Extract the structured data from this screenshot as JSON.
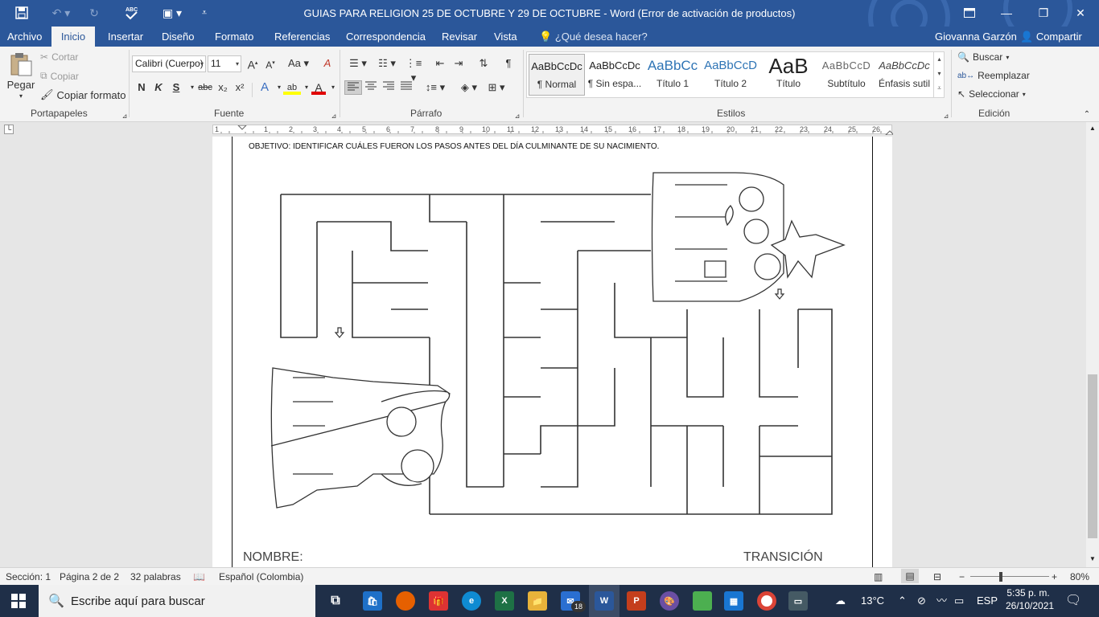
{
  "window": {
    "title": "GUIAS PARA RELIGION 25 DE OCTUBRE Y 29 DE OCTUBRE  -  Word (Error de activación de productos)",
    "minimize": "—",
    "restore": "❐",
    "close": "✕"
  },
  "quick_access": {
    "save_icon": "save-icon",
    "undo_icon": "undo-icon",
    "redo_icon": "redo-icon",
    "spelling_icon": "spelling-icon",
    "form_icon": "form-icon"
  },
  "menu": {
    "tabs": [
      "Archivo",
      "Inicio",
      "Insertar",
      "Diseño",
      "Formato",
      "Referencias",
      "Correspondencia",
      "Revisar",
      "Vista"
    ],
    "active_tab": "Inicio",
    "tell_me": "¿Qué desea hacer?",
    "user": "Giovanna Garzón",
    "share": "Compartir"
  },
  "ribbon": {
    "clipboard": {
      "paste": "Pegar",
      "cut": "Cortar",
      "copy": "Copiar",
      "format_painter": "Copiar formato",
      "label": "Portapapeles"
    },
    "font": {
      "name": "Calibri (Cuerpo)",
      "size": "11",
      "label": "Fuente",
      "bold": "N",
      "italic": "K",
      "underline": "S",
      "strike": "abc",
      "subscript": "x₂",
      "superscript": "x²",
      "grow": "A",
      "shrink": "A",
      "case": "Aa",
      "clear": "A",
      "effects": "A",
      "highlight": "ab",
      "color": "A"
    },
    "paragraph": {
      "label": "Párrafo"
    },
    "styles": {
      "label": "Estilos",
      "items": [
        {
          "sample": "AaBbCcDc",
          "name": "¶ Normal"
        },
        {
          "sample": "AaBbCcDc",
          "name": "¶ Sin espa..."
        },
        {
          "sample": "AaBbCc",
          "name": "Título 1"
        },
        {
          "sample": "AaBbCcD",
          "name": "Título 2"
        },
        {
          "sample": "AaB",
          "name": "Título"
        },
        {
          "sample": "AaBbCcD",
          "name": "Subtítulo"
        },
        {
          "sample": "AaBbCcDc",
          "name": "Énfasis sutil"
        }
      ]
    },
    "editing": {
      "find": "Buscar",
      "replace": "Reemplazar",
      "select": "Seleccionar",
      "label": "Edición"
    }
  },
  "ruler": {
    "numbers": [
      "1",
      "1",
      "2",
      "3",
      "4",
      "5",
      "6",
      "7",
      "8",
      "9",
      "10",
      "11",
      "12",
      "13",
      "14",
      "15",
      "16",
      "17",
      "18",
      "19",
      "20",
      "21",
      "22",
      "23",
      "24",
      "25",
      "26"
    ]
  },
  "document": {
    "objective": "OBJETIVO: IDENTIFICAR CUÁLES FUERON LOS PASOS ANTES DEL DÍA CULMINANTE DE SU NACIMIENTO.",
    "footer_left": "NOMBRE:",
    "footer_right": "TRANSICIÓN"
  },
  "status": {
    "section": "Sección: 1",
    "page": "Página 2 de 2",
    "words": "32 palabras",
    "language": "Español (Colombia)",
    "zoom": "80%",
    "zoom_level": 0.8
  },
  "taskbar": {
    "search_placeholder": "Escribe aquí para buscar",
    "weather": "13°C",
    "lang": "ESP",
    "time": "5:35 p. m.",
    "date": "26/10/2021",
    "mail_badge": "18",
    "apps": [
      "task-view",
      "store",
      "firefox",
      "gift",
      "edge",
      "excel",
      "file-explorer",
      "mail",
      "word",
      "powerpoint",
      "paint",
      "game",
      "app-blue",
      "chrome",
      "media"
    ]
  },
  "colors": {
    "brand": "#2b579a",
    "taskbar": "#1f2f48"
  }
}
